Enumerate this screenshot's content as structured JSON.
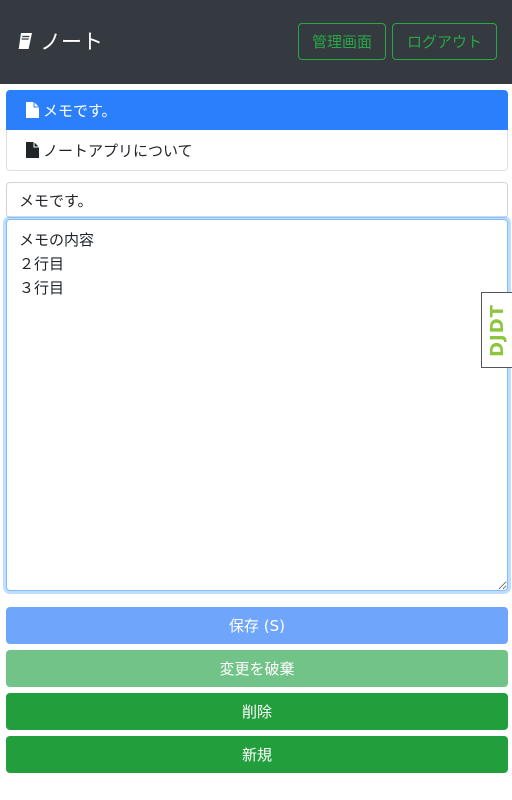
{
  "header": {
    "brand_icon": "book-icon",
    "brand_title": "ノート",
    "admin_button": "管理画面",
    "logout_button": "ログアウト"
  },
  "notes": {
    "items": [
      {
        "icon": "file-icon",
        "title": "メモです。",
        "active": true
      },
      {
        "icon": "file-icon",
        "title": "ノートアプリについて",
        "active": false
      }
    ]
  },
  "editor": {
    "title_value": "メモです。",
    "content_value": "メモの内容\n２行目\n３行目"
  },
  "side_tab": {
    "label": "DJDT"
  },
  "actions": {
    "save": "保存 (S)",
    "discard": "変更を破棄",
    "delete": "削除",
    "new": "新規"
  },
  "colors": {
    "navbar": "#343a40",
    "primary": "#2c7ffb",
    "success": "#28a745",
    "save_disabled": "#6fa6fb",
    "discard_disabled": "#71c387",
    "success_button": "#239e3d"
  }
}
